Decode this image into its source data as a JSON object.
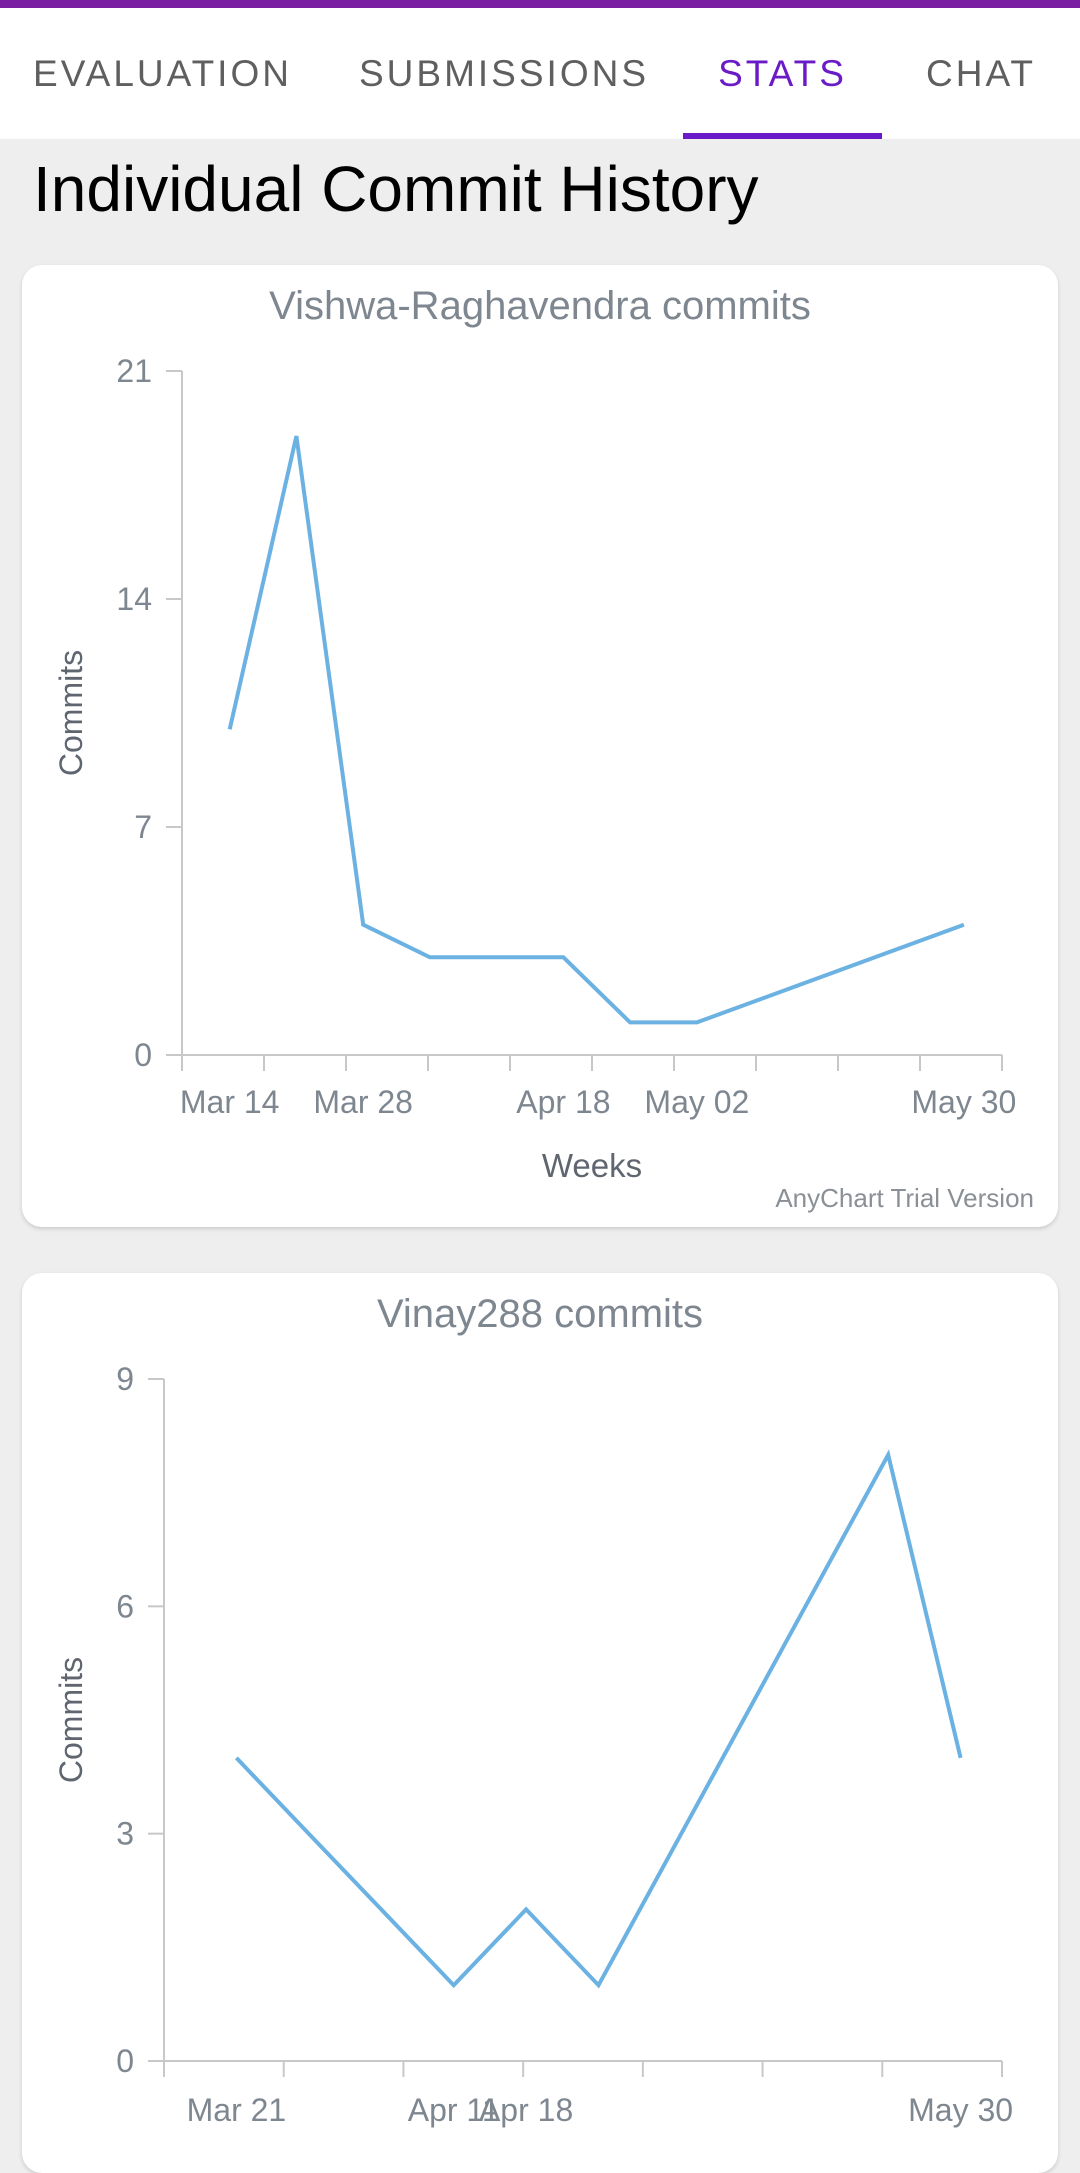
{
  "tabs": [
    {
      "label": "EVALUATION",
      "active": false
    },
    {
      "label": "SUBMISSIONS",
      "active": false
    },
    {
      "label": "STATS",
      "active": true
    },
    {
      "label": "CHAT",
      "active": false
    }
  ],
  "colors": {
    "accent": "#6a1bc7",
    "top_bar": "#7b1fa2",
    "line": "#6bb2e3"
  },
  "page_title": "Individual Commit History",
  "watermark": "AnyChart Trial Version",
  "chart_data": [
    {
      "type": "line",
      "title": "Vishwa-Raghavendra commits",
      "xlabel": "Weeks",
      "ylabel": "Commits",
      "x_ticks": [
        "Mar 14",
        "Mar 28",
        "Apr 18",
        "May 02",
        "May 30"
      ],
      "ylim": [
        0,
        21
      ],
      "y_ticks": [
        0,
        7,
        14,
        21
      ],
      "x": [
        "Mar 14",
        "Mar 21",
        "Mar 28",
        "Apr 04",
        "Apr 18",
        "Apr 25",
        "May 02",
        "May 30"
      ],
      "values": [
        10,
        19,
        4,
        3,
        3,
        1,
        1,
        4
      ]
    },
    {
      "type": "line",
      "title": "Vinay288 commits",
      "xlabel": "",
      "ylabel": "Commits",
      "x_ticks": [
        "Mar 21",
        "Apr 11",
        "Apr 18",
        "May 30"
      ],
      "ylim": [
        0,
        9
      ],
      "y_ticks": [
        0,
        3,
        6,
        9
      ],
      "x": [
        "Mar 21",
        "Mar 28",
        "Apr 11",
        "Apr 18",
        "Apr 25",
        "May 23",
        "May 30"
      ],
      "values": [
        4,
        3,
        1,
        2,
        1,
        8,
        4
      ]
    }
  ]
}
